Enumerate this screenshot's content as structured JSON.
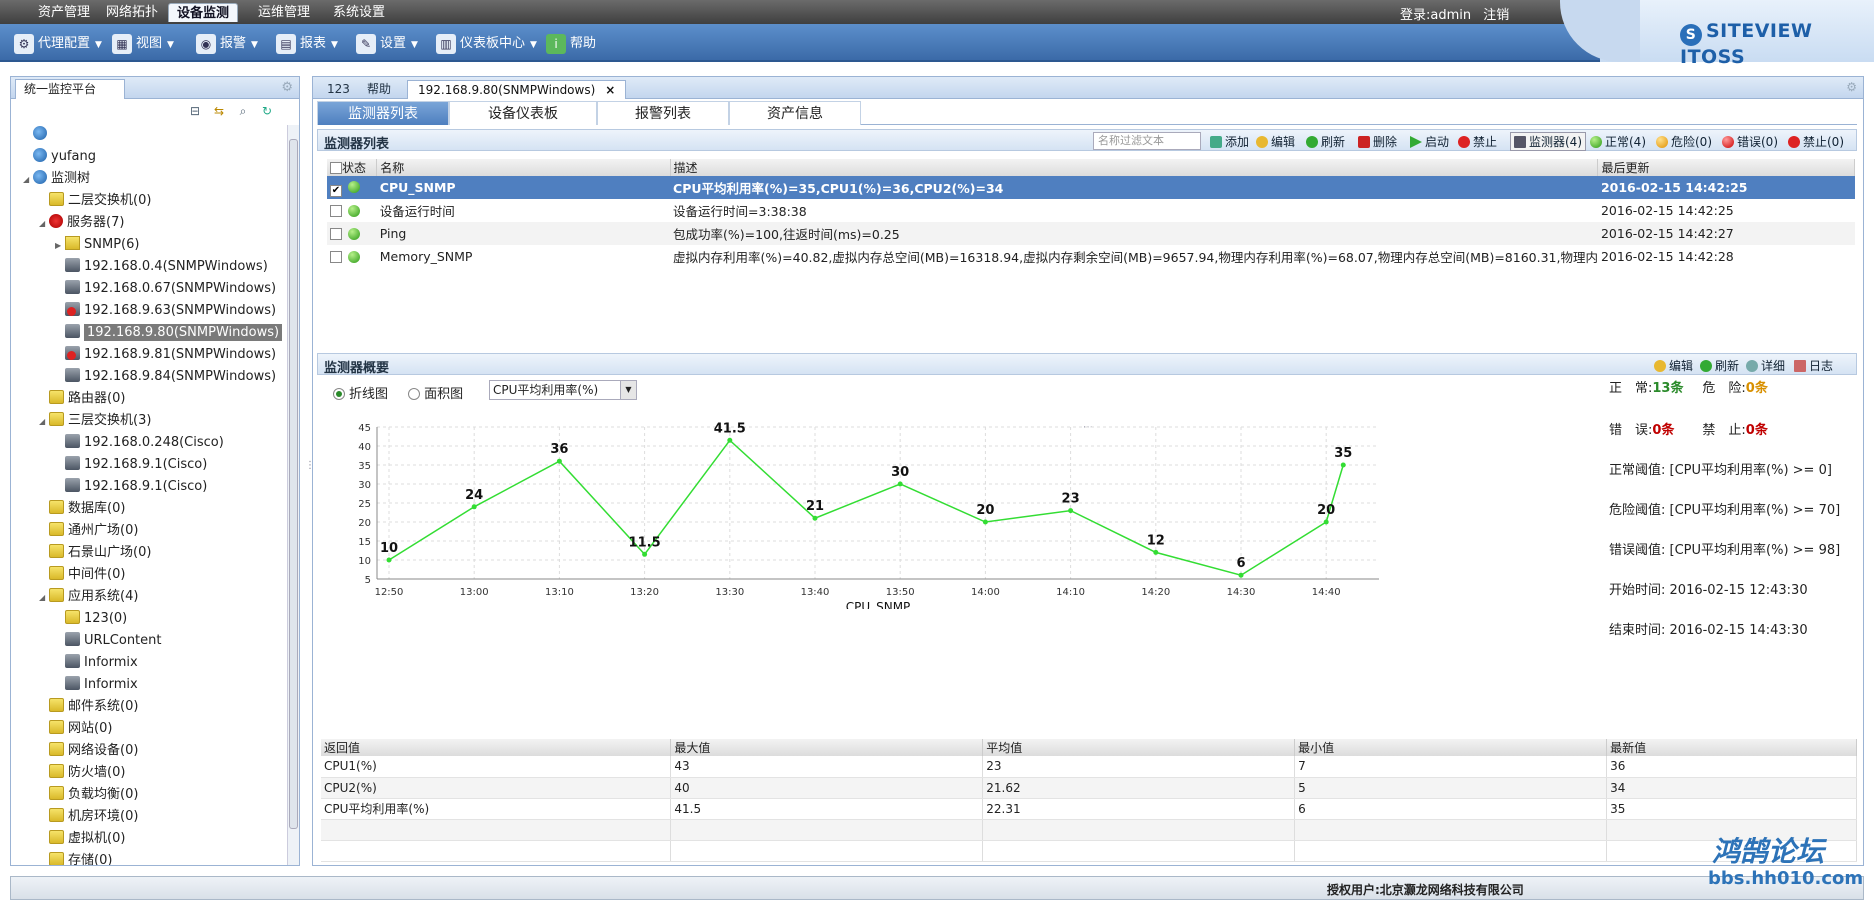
{
  "menu": {
    "items": [
      "资产管理",
      "网络拓扑",
      "设备监测",
      "运维管理",
      "系统设置"
    ],
    "active_index": 2,
    "login_label": "登录:admin",
    "logout_label": "注销"
  },
  "brand": {
    "name": "SITEVIEW ITOSS"
  },
  "toolbar": {
    "items": [
      {
        "label": "代理配置",
        "icon": "proxy-icon"
      },
      {
        "label": "视图",
        "icon": "view-icon"
      },
      {
        "label": "报警",
        "icon": "alarm-icon"
      },
      {
        "label": "报表",
        "icon": "report-icon"
      },
      {
        "label": "设置",
        "icon": "settings-icon"
      },
      {
        "label": "仪表板中心",
        "icon": "dashboard-icon"
      },
      {
        "label": "帮助",
        "icon": "help-icon"
      }
    ]
  },
  "left": {
    "tab_label": "统一监控平台",
    "tree": [
      {
        "label": "",
        "icon": "globe",
        "level": 0
      },
      {
        "label": "yufang",
        "icon": "globe",
        "level": 0
      },
      {
        "label": "监测树",
        "icon": "globe",
        "level": 0,
        "expand": "open"
      },
      {
        "label": "二层交换机(0)",
        "icon": "folder",
        "level": 1
      },
      {
        "label": "服务器(7)",
        "icon": "srv",
        "level": 1,
        "expand": "open"
      },
      {
        "label": "SNMP(6)",
        "icon": "snmp",
        "level": 2,
        "expand": "closed"
      },
      {
        "label": "192.168.0.4(SNMPWindows)",
        "icon": "host",
        "level": 2
      },
      {
        "label": "192.168.0.67(SNMPWindows)",
        "icon": "host",
        "level": 2
      },
      {
        "label": "192.168.9.63(SNMPWindows)",
        "icon": "hostred",
        "level": 2
      },
      {
        "label": "192.168.9.80(SNMPWindows)",
        "icon": "host",
        "level": 2,
        "selected": true
      },
      {
        "label": "192.168.9.81(SNMPWindows)",
        "icon": "hostred",
        "level": 2
      },
      {
        "label": "192.168.9.84(SNMPWindows)",
        "icon": "host",
        "level": 2
      },
      {
        "label": "路由器(0)",
        "icon": "folder",
        "level": 1
      },
      {
        "label": "三层交换机(3)",
        "icon": "folder",
        "level": 1,
        "expand": "open"
      },
      {
        "label": "192.168.0.248(Cisco)",
        "icon": "host",
        "level": 2
      },
      {
        "label": "192.168.9.1(Cisco)",
        "icon": "host",
        "level": 2
      },
      {
        "label": "192.168.9.1(Cisco)",
        "icon": "host",
        "level": 2
      },
      {
        "label": "数据库(0)",
        "icon": "folder",
        "level": 1
      },
      {
        "label": "通州广场(0)",
        "icon": "folder",
        "level": 1
      },
      {
        "label": "石景山广场(0)",
        "icon": "folder",
        "level": 1
      },
      {
        "label": "中间件(0)",
        "icon": "folder",
        "level": 1
      },
      {
        "label": "应用系统(4)",
        "icon": "folder",
        "level": 1,
        "expand": "open"
      },
      {
        "label": "123(0)",
        "icon": "folder",
        "level": 2
      },
      {
        "label": "URLContent",
        "icon": "host",
        "level": 2
      },
      {
        "label": "Informix",
        "icon": "host",
        "level": 2
      },
      {
        "label": "Informix",
        "icon": "host",
        "level": 2
      },
      {
        "label": "邮件系统(0)",
        "icon": "folder",
        "level": 1
      },
      {
        "label": "网站(0)",
        "icon": "folder",
        "level": 1
      },
      {
        "label": "网络设备(0)",
        "icon": "folder",
        "level": 1
      },
      {
        "label": "防火墙(0)",
        "icon": "folder",
        "level": 1
      },
      {
        "label": "负载均衡(0)",
        "icon": "folder",
        "level": 1
      },
      {
        "label": "机房环境(0)",
        "icon": "folder",
        "level": 1
      },
      {
        "label": "虚拟机(0)",
        "icon": "folder",
        "level": 1
      },
      {
        "label": "存储(0)",
        "icon": "folder",
        "level": 1
      }
    ]
  },
  "main": {
    "tabs": [
      {
        "label": "123"
      },
      {
        "label": "帮助"
      },
      {
        "label": "192.168.9.80(SNMPWindows)",
        "active": true,
        "closable": "×"
      }
    ],
    "subtabs": [
      "监测器列表",
      "设备仪表板",
      "报警列表",
      "资产信息"
    ],
    "list_section": {
      "title": "监测器列表",
      "filter_placeholder": "名称过滤文本",
      "actions": [
        "添加",
        "编辑",
        "刷新",
        "删除",
        "启动",
        "禁止"
      ],
      "monitor_btn": "监测器(4)",
      "counts": [
        "正常(4)",
        "危险(0)",
        "错误(0)",
        "禁止(0)"
      ],
      "columns": [
        "状态",
        "名称",
        "描述",
        "最后更新"
      ],
      "rows": [
        {
          "checked": true,
          "name": "CPU_SNMP",
          "desc": "CPU平均利用率(%)=35,CPU1(%)=36,CPU2(%)=34",
          "updated": "2016-02-15 14:42:25"
        },
        {
          "checked": false,
          "name": "设备运行时间",
          "desc": "设备运行时间=3:38:38",
          "updated": "2016-02-15 14:42:25"
        },
        {
          "checked": false,
          "name": "Ping",
          "desc": "包成功率(%)=100,往返时间(ms)=0.25",
          "updated": "2016-02-15 14:42:27"
        },
        {
          "checked": false,
          "name": "Memory_SNMP",
          "desc": "虚拟内存利用率(%)=40.82,虚拟内存总空间(MB)=16318.94,虚拟内存剩余空间(MB)=9657.94,物理内存利用率(%)=68.07,物理内存总空间(MB)=8160.31,物理内",
          "updated": "2016-02-15 14:42:28"
        }
      ]
    },
    "overview": {
      "title": "监测器概要",
      "actions": [
        "编辑",
        "刷新",
        "详细",
        "日志"
      ],
      "chart_type_line": "折线图",
      "chart_type_area": "面积图",
      "metric_select": "CPU平均利用率(%)",
      "stats": {
        "normal_label": "正　常:",
        "normal_value": "13条",
        "danger_label": "危　险:",
        "danger_value": "0条",
        "error_label": "错　误:",
        "error_value": "0条",
        "disabled_label": "禁　止:",
        "disabled_value": "0条",
        "normal_threshold_label": "正常阈值:",
        "normal_threshold": "[CPU平均利用率(%) >= 0]",
        "danger_threshold_label": "危险阈值:",
        "danger_threshold": "[CPU平均利用率(%) >= 70]",
        "error_threshold_label": "错误阈值:",
        "error_threshold": "[CPU平均利用率(%) >= 98]",
        "start_label": "开始时间:",
        "start_time": "2016-02-15 12:43:30",
        "end_label": "结束时间:",
        "end_time": "2016-02-15 14:43:30"
      },
      "summary_columns": [
        "返回值",
        "最大值",
        "平均值",
        "最小值",
        "最新值"
      ],
      "summary_rows": [
        [
          "CPU1(%)",
          "43",
          "23",
          "7",
          "36"
        ],
        [
          "CPU2(%)",
          "40",
          "21.62",
          "5",
          "34"
        ],
        [
          "CPU平均利用率(%)",
          "41.5",
          "22.31",
          "6",
          "35"
        ],
        [
          "",
          "",
          "",
          "",
          ""
        ],
        [
          "",
          "",
          "",
          "",
          ""
        ]
      ]
    }
  },
  "chart_data": {
    "type": "line",
    "xlabel": "CPU_SNMP",
    "ylabel": "",
    "ylim": [
      5,
      45
    ],
    "yticks": [
      5,
      10,
      15,
      20,
      25,
      30,
      35,
      40,
      45
    ],
    "xticks": [
      "12:50",
      "13:00",
      "13:10",
      "13:20",
      "13:30",
      "13:40",
      "13:50",
      "14:00",
      "14:10",
      "14:20",
      "14:30",
      "14:40"
    ],
    "x": [
      "12:50",
      "13:00",
      "13:10",
      "13:20",
      "13:30",
      "13:40",
      "13:50",
      "14:00",
      "14:10",
      "14:20",
      "14:30",
      "14:40",
      "14:42"
    ],
    "x_minutes_from_1250": [
      0,
      10,
      20,
      30,
      40,
      50,
      60,
      70,
      80,
      90,
      100,
      110,
      112
    ],
    "values": [
      10,
      24,
      36,
      11.5,
      41.5,
      21,
      30,
      20,
      23,
      12,
      6,
      20,
      35
    ],
    "labels": [
      "10",
      "24",
      "36",
      "11.5",
      "41.5",
      "21",
      "30",
      "20",
      "23",
      "12",
      "6",
      "20",
      "35"
    ],
    "line_color": "#33dd33",
    "grid": true
  },
  "status": {
    "licensed": "授权用户:北京灏龙网络科技有限公司"
  },
  "watermark": {
    "line1": "鸿鹄论坛",
    "line2": "bbs.hh010.com"
  }
}
